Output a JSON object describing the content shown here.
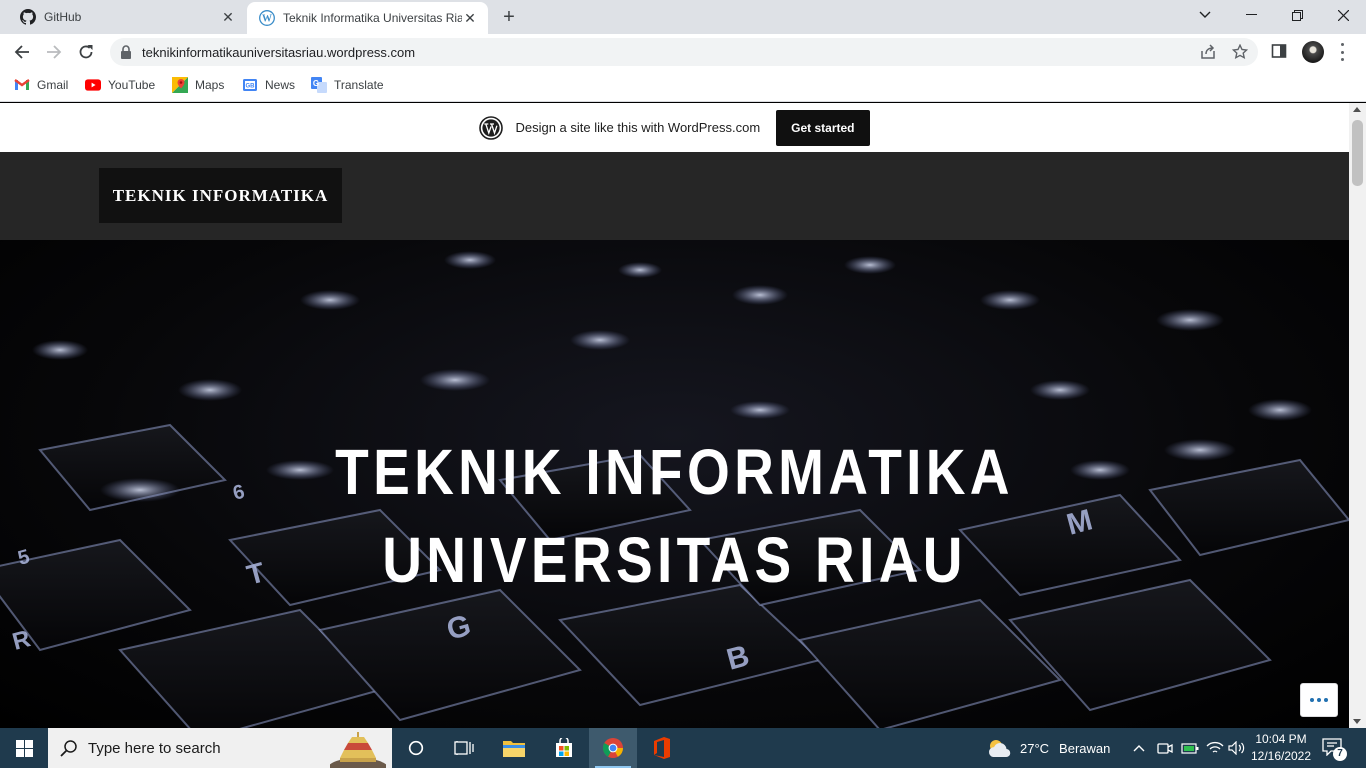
{
  "browser": {
    "tabs": [
      {
        "title": "GitHub",
        "icon": "github-icon"
      },
      {
        "title": "Teknik Informatika Universitas Riau",
        "icon": "wordpress-icon",
        "active": true
      }
    ],
    "url": "teknikinformatikauniversitasriau.wordpress.com",
    "bookmarks": [
      {
        "label": "Gmail",
        "icon": "gmail-icon"
      },
      {
        "label": "YouTube",
        "icon": "youtube-icon"
      },
      {
        "label": "Maps",
        "icon": "maps-icon"
      },
      {
        "label": "News",
        "icon": "news-icon"
      },
      {
        "label": "Translate",
        "icon": "translate-icon"
      }
    ]
  },
  "wp_banner": {
    "message": "Design a site like this with WordPress.com",
    "button": "Get started"
  },
  "site": {
    "brand": "TEKNIK INFORMATIKA",
    "hero_line1": "TEKNIK INFORMATIKA",
    "hero_line2": "UNIVERSITAS RIAU"
  },
  "taskbar": {
    "search_placeholder": "Type here to search",
    "weather_temp": "27°C",
    "weather_desc": "Berawan",
    "time": "10:04 PM",
    "date": "12/16/2022",
    "notification_count": "7"
  },
  "colors": {
    "tabstrip": "#dee1e6",
    "taskbar": "#1f3a4d",
    "site_header": "#262626",
    "wp_button": "#101010",
    "key_glow": "#9aa6d8"
  }
}
